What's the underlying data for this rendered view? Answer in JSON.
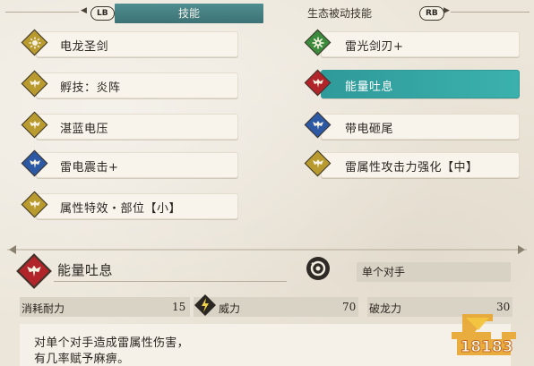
{
  "tabs": {
    "prev_button": "LB",
    "next_button": "RB",
    "items": [
      {
        "label": "技能",
        "active": true
      },
      {
        "label": "生态被动技能",
        "active": false
      }
    ]
  },
  "skills": [
    {
      "name": "电龙圣剑",
      "column": "left",
      "icon": "gold-sword-icon",
      "color": "#b99a2f"
    },
    {
      "name": "孵技：炎阵",
      "column": "left",
      "icon": "gold-bird-icon",
      "color": "#b99a2f"
    },
    {
      "name": "湛蓝电压",
      "column": "left",
      "icon": "gold-bird-icon",
      "color": "#b99a2f"
    },
    {
      "name": "雷电震击+",
      "column": "left",
      "icon": "blue-bird-icon",
      "color": "#2d58a3"
    },
    {
      "name": "属性特效・部位【小】",
      "column": "left",
      "icon": "gold-bird-icon",
      "color": "#b99a2f"
    },
    {
      "name": "雷光剑刃+",
      "column": "right",
      "icon": "green-gear-icon",
      "color": "#3c8a3c"
    },
    {
      "name": "能量吐息",
      "column": "right",
      "icon": "red-bird-icon",
      "color": "#b0242a",
      "selected": true
    },
    {
      "name": "带电砸尾",
      "column": "right",
      "icon": "blue-bird-icon",
      "color": "#2d58a3"
    },
    {
      "name": "雷属性攻击力强化【中】",
      "column": "right",
      "icon": "gold-bird-icon",
      "color": "#b99a2f"
    }
  ],
  "detail": {
    "title": "能量吐息",
    "icon": "red-bird-icon",
    "target_icon": "target-icon",
    "target": "单个对手",
    "stats": [
      {
        "label": "消耗耐力",
        "value": "15"
      },
      {
        "label": "威力",
        "value": "70",
        "icon": "lightning-icon"
      },
      {
        "label": "破龙力",
        "value": "30"
      }
    ],
    "description": [
      "对单个对手造成雷属性伤害，",
      "有几率赋予麻痹。"
    ]
  },
  "watermark": "18183",
  "colors": {
    "accent_teal": "#3c8a8d",
    "selected": "#34a5a3",
    "gold": "#b99a2f",
    "red": "#b0242a",
    "blue": "#2d58a3",
    "green": "#3c8a3c"
  }
}
